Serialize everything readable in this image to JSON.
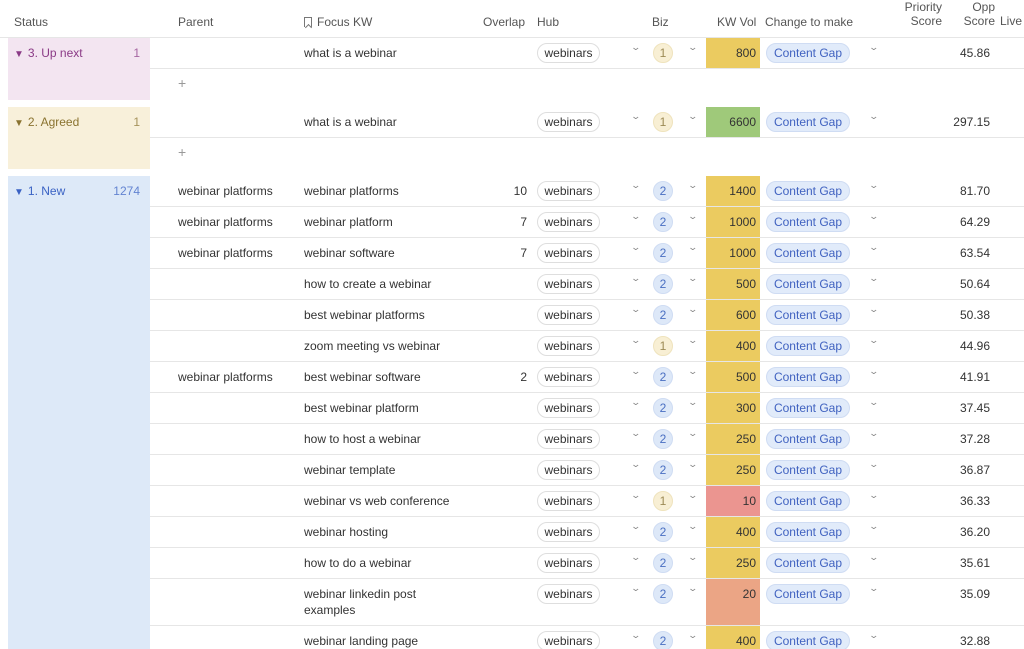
{
  "header": {
    "status": "Status",
    "parent": "Parent",
    "focus_kw": "Focus KW",
    "overlap": "Overlap",
    "hub": "Hub",
    "biz": "Biz",
    "kw_vol": "KW Vol",
    "change_to_make": "Change to make",
    "priority_score_1": "Priority",
    "priority_score_2": "Score",
    "opp_score_1": "Opp",
    "opp_score_2": "Score",
    "live": "Live"
  },
  "colors": {
    "up_next_bg": "#f3e5f1",
    "up_next_text": "#8a3a86",
    "agreed_bg": "#f8f0da",
    "agreed_text": "#8a7330",
    "new_bg": "#dde9f8",
    "new_text": "#3a62c4",
    "kw_yellow": "#ebcb60",
    "kw_green": "#9fc97a",
    "kw_red": "#eb9590",
    "kw_orange": "#eba585"
  },
  "groups": [
    {
      "name": "3. Up next",
      "count": "1",
      "add_label": "+",
      "rows": [
        {
          "parent": "",
          "focus": "what is a webinar",
          "overlap": "",
          "hub": "webinars",
          "biz": "1",
          "kw_vol": "800",
          "kw_color": "yellow",
          "change": "Content Gap",
          "opp": "45.86"
        }
      ]
    },
    {
      "name": "2. Agreed",
      "count": "1",
      "add_label": "+",
      "rows": [
        {
          "parent": "",
          "focus": "what is a webinar",
          "overlap": "",
          "hub": "webinars",
          "biz": "1",
          "kw_vol": "6600",
          "kw_color": "green",
          "change": "Content Gap",
          "opp": "297.15"
        }
      ]
    },
    {
      "name": "1. New",
      "count": "1274",
      "rows": [
        {
          "parent": "webinar platforms",
          "focus": "webinar platforms",
          "overlap": "10",
          "hub": "webinars",
          "biz": "2",
          "kw_vol": "1400",
          "kw_color": "yellow",
          "change": "Content Gap",
          "opp": "81.70"
        },
        {
          "parent": "webinar platforms",
          "focus": "webinar platform",
          "overlap": "7",
          "hub": "webinars",
          "biz": "2",
          "kw_vol": "1000",
          "kw_color": "yellow",
          "change": "Content Gap",
          "opp": "64.29"
        },
        {
          "parent": "webinar platforms",
          "focus": "webinar software",
          "overlap": "7",
          "hub": "webinars",
          "biz": "2",
          "kw_vol": "1000",
          "kw_color": "yellow",
          "change": "Content Gap",
          "opp": "63.54"
        },
        {
          "parent": "",
          "focus": "how to create a webinar",
          "overlap": "",
          "hub": "webinars",
          "biz": "2",
          "kw_vol": "500",
          "kw_color": "yellow",
          "change": "Content Gap",
          "opp": "50.64"
        },
        {
          "parent": "",
          "focus": "best webinar platforms",
          "overlap": "",
          "hub": "webinars",
          "biz": "2",
          "kw_vol": "600",
          "kw_color": "yellow",
          "change": "Content Gap",
          "opp": "50.38"
        },
        {
          "parent": "",
          "focus": "zoom meeting vs webinar",
          "overlap": "",
          "hub": "webinars",
          "biz": "1",
          "kw_vol": "400",
          "kw_color": "yellow",
          "change": "Content Gap",
          "opp": "44.96"
        },
        {
          "parent": "webinar platforms",
          "focus": "best webinar software",
          "overlap": "2",
          "hub": "webinars",
          "biz": "2",
          "kw_vol": "500",
          "kw_color": "yellow",
          "change": "Content Gap",
          "opp": "41.91"
        },
        {
          "parent": "",
          "focus": "best webinar platform",
          "overlap": "",
          "hub": "webinars",
          "biz": "2",
          "kw_vol": "300",
          "kw_color": "yellow",
          "change": "Content Gap",
          "opp": "37.45"
        },
        {
          "parent": "",
          "focus": "how to host a webinar",
          "overlap": "",
          "hub": "webinars",
          "biz": "2",
          "kw_vol": "250",
          "kw_color": "yellow",
          "change": "Content Gap",
          "opp": "37.28"
        },
        {
          "parent": "",
          "focus": "webinar template",
          "overlap": "",
          "hub": "webinars",
          "biz": "2",
          "kw_vol": "250",
          "kw_color": "yellow",
          "change": "Content Gap",
          "opp": "36.87"
        },
        {
          "parent": "",
          "focus": "webinar vs web conference",
          "overlap": "",
          "hub": "webinars",
          "biz": "1",
          "kw_vol": "10",
          "kw_color": "red",
          "change": "Content Gap",
          "opp": "36.33"
        },
        {
          "parent": "",
          "focus": "webinar hosting",
          "overlap": "",
          "hub": "webinars",
          "biz": "2",
          "kw_vol": "400",
          "kw_color": "yellow",
          "change": "Content Gap",
          "opp": "36.20"
        },
        {
          "parent": "",
          "focus": "how to do a webinar",
          "overlap": "",
          "hub": "webinars",
          "biz": "2",
          "kw_vol": "250",
          "kw_color": "yellow",
          "change": "Content Gap",
          "opp": "35.61"
        },
        {
          "parent": "",
          "focus": "webinar linkedin post",
          "focus2": "examples",
          "overlap": "",
          "hub": "webinars",
          "biz": "2",
          "kw_vol": "20",
          "kw_color": "orange",
          "change": "Content Gap",
          "opp": "35.09",
          "tall": true
        },
        {
          "parent": "",
          "focus": "webinar landing page",
          "overlap": "",
          "hub": "webinars",
          "biz": "2",
          "kw_vol": "400",
          "kw_color": "yellow",
          "change": "Content Gap",
          "opp": "32.88"
        }
      ]
    }
  ]
}
